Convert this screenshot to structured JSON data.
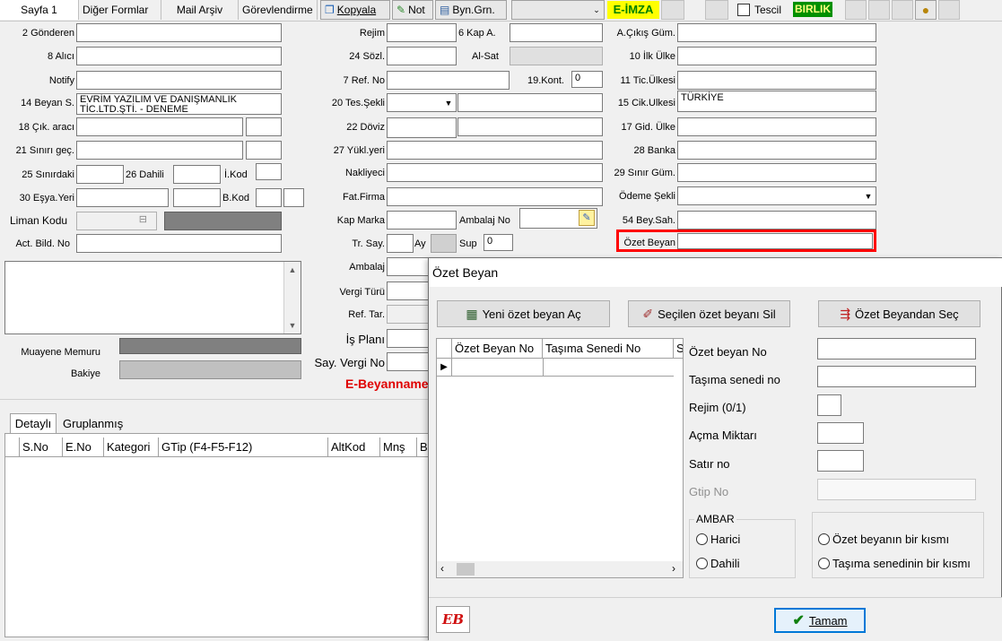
{
  "tabs": [
    "Sayfa 1",
    "Diğer Formlar",
    "Mail Arşiv",
    "Görevlendirme"
  ],
  "toolbar": {
    "kopyala": "Kopyala",
    "not": "Not",
    "byn": "Byn.Grn.",
    "eimza": "E-İMZA",
    "tescil": "Tescil",
    "birlik": "BIRLIK"
  },
  "left": {
    "gonderen": "2 Gönderen",
    "alici": "8 Alıcı",
    "notify": "Notify",
    "beyan": "14 Beyan S.",
    "beyan_value": "EVRİM YAZILIM VE DANIŞMANLIK TİC.LTD.ŞTİ. - DENEME",
    "cik_arac": "18 Çık. aracı",
    "sinir_gec": "21 Sınırı geç.",
    "sinirdaki": "25 Sınırdaki",
    "dahili26": "26 Dahili",
    "ikod": "İ.Kod",
    "esya_yeri": "30 Eşya.Yeri",
    "bkod": "B.Kod",
    "liman_kodu": "Liman Kodu",
    "act_bild": "Act. Bild. No",
    "muayene": "Muayene Memuru",
    "bakiye": "Bakiye"
  },
  "middle": {
    "rejim": "Rejim",
    "kap6": "6 Kap A.",
    "sozl24": "24 Sözl.",
    "alsat": "Al-Sat",
    "ref7": "7 Ref. No",
    "kont19": "19.Kont.",
    "kont_val": "0",
    "tes_sekli": "20 Tes.Şekli",
    "doviz": "22 Döviz",
    "yukl": "27 Yükl.yeri",
    "nakliyeci": "Nakliyeci",
    "fat_firma": "Fat.Firma",
    "kap_marka": "Kap Marka",
    "ambalaj_no": "Ambalaj No",
    "tr_say": "Tr. Say.",
    "ay": "Ay",
    "sup": "Sup",
    "sup_val": "0",
    "ambalaj": "Ambalaj",
    "vergi_turu": "Vergi Türü",
    "ref_tar": "Ref. Tar.",
    "is_plani": "İş Planı",
    "say_vergi": "Say. Vergi No",
    "ebeyan": "E-Beyanname"
  },
  "right": {
    "a_cikis": "A.Çıkış Güm.",
    "ilk_ulke": "10 İlk Ülke",
    "tic_ulke": "11 Tic.Ülkesi",
    "cik_ulke": "15 Cik.Ulkesi",
    "cik_ulke_val": "TÜRKİYE",
    "gid_ulke": "17 Gid. Ülke",
    "banka": "28 Banka",
    "sinir_gum": "29 Sınır Güm.",
    "odeme": "Ödeme Şekli",
    "bey_sah": "54 Bey.Sah.",
    "ozet_beyan": "Özet Beyan"
  },
  "bottom": {
    "tabs": [
      "Detaylı",
      "Gruplanmış"
    ],
    "columns": [
      "S.No",
      "E.No",
      "Kategori",
      "GTip (F4-F5-F12)",
      "AltKod",
      "Mnş",
      "B"
    ]
  },
  "dialog": {
    "title": "Özet Beyan",
    "btn_yeni": "Yeni özet beyan Aç",
    "btn_sil": "Seçilen özet beyanı Sil",
    "btn_sec": "Özet Beyandan Seç",
    "grid_cols": [
      "Özet Beyan No",
      "Taşıma Senedi No",
      "S"
    ],
    "ozet_no": "Özet beyan No",
    "tasima_no": "Taşıma senedi no",
    "rejim": "Rejim  (0/1)",
    "acma": "Açma Miktarı",
    "satir": "Satır no",
    "gtip": "Gtip No",
    "ambar": "AMBAR",
    "harici": "Harici",
    "dahili": "Dahili",
    "bir_kismi": "Özet beyanın bir kısmı",
    "tasima_kismi": "Taşıma senedinin bir kısmı",
    "tamam": "Tamam",
    "logo": "EB"
  },
  "colors": {
    "highlight": "#ff0000",
    "eimza_bg": "#ffff00",
    "eimza_fg": "#008000",
    "birlik_bg": "#009000",
    "ebeyan": "#e00000"
  }
}
